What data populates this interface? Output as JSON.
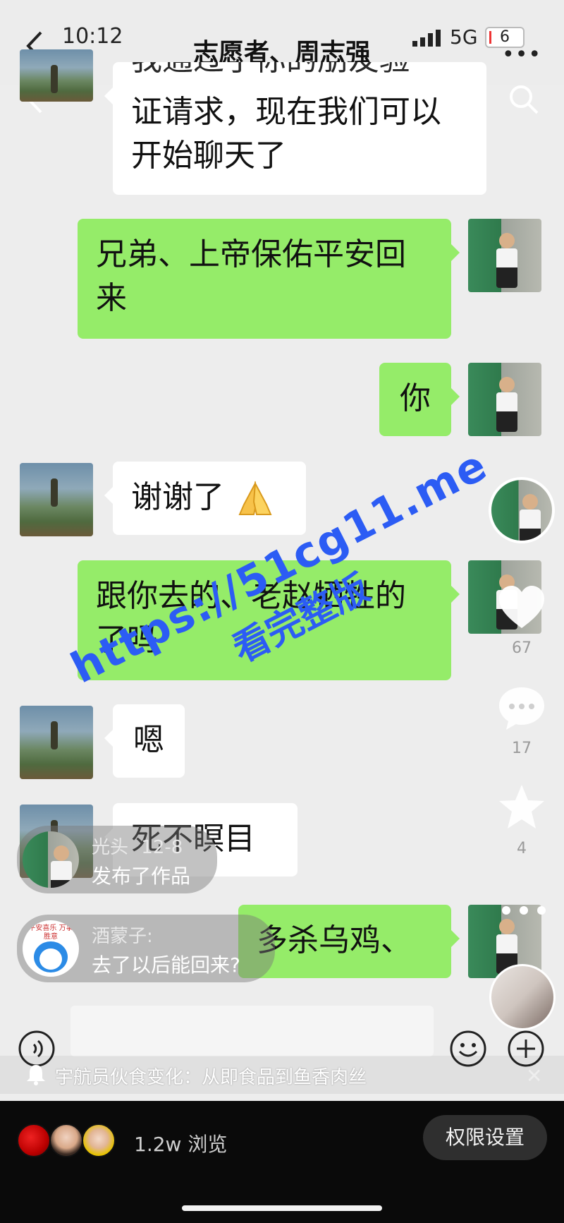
{
  "status_bar": {
    "time": "10:12",
    "network": "5G",
    "battery": "6"
  },
  "chat": {
    "title": "志愿者、周志强",
    "messages": [
      {
        "side": "in",
        "text": "证请求，现在我们可以开始聊天了",
        "partial_top": "我通过了你的朋友验"
      },
      {
        "side": "out",
        "text": "兄弟、上帝保佑平安回来"
      },
      {
        "side": "out",
        "text": "你"
      },
      {
        "side": "in",
        "text": "谢谢了",
        "emoji": "folded-hands"
      },
      {
        "side": "out",
        "text": "跟你去的、老赵牺牲的了吗"
      },
      {
        "side": "in",
        "text": "嗯"
      },
      {
        "side": "in",
        "text": "死不瞑目"
      },
      {
        "side": "out",
        "text": "多杀乌鸡、"
      }
    ]
  },
  "video_rail": {
    "like_count": "67",
    "comment_count": "17",
    "favorite_count": "4"
  },
  "notifications": [
    {
      "user": "光头",
      "date": "12-8",
      "text": "发布了作品"
    },
    {
      "user": "酒蒙子:",
      "text": "去了以后能回来?"
    }
  ],
  "watermark": {
    "line1": "https://51cg11.me",
    "line2": "看完整版"
  },
  "ticker": {
    "text": "宇航员伙食变化：从即食品到鱼香肉丝"
  },
  "bottom_bar": {
    "views": "1.2w 浏览",
    "permission_button": "权限设置"
  },
  "avatar_caption": {
    "doraemon_text": "平安喜乐 万事胜意"
  }
}
